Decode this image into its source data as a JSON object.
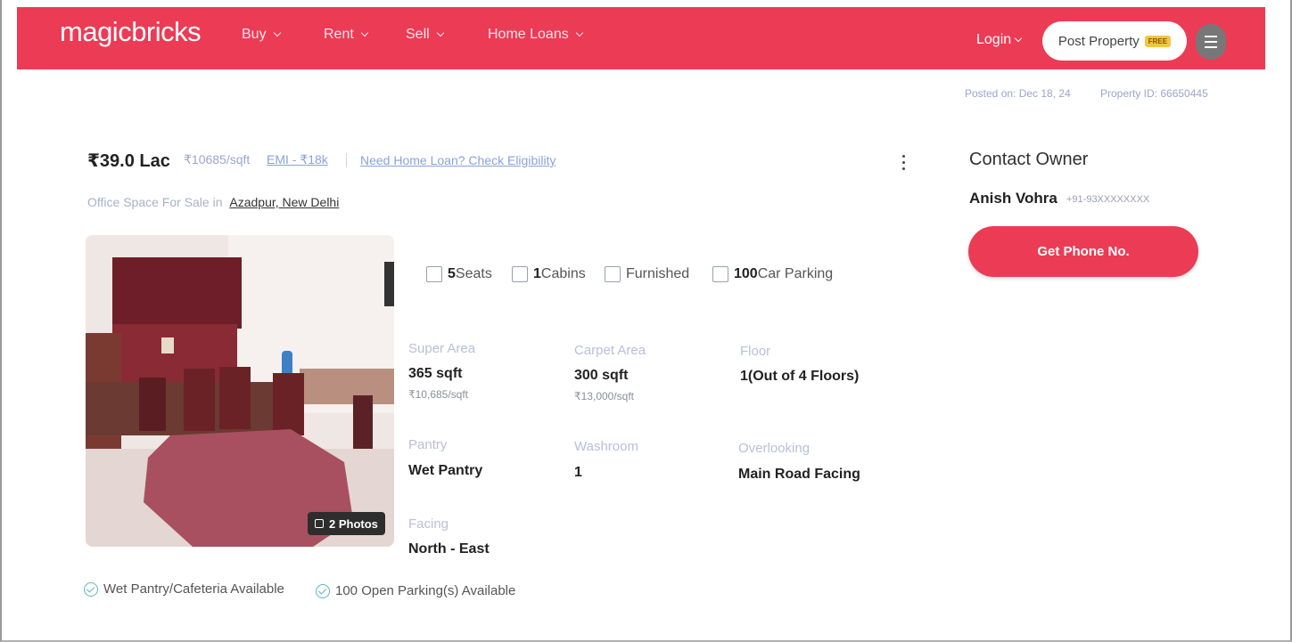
{
  "header": {
    "logo": "magicbricks",
    "nav": [
      {
        "label": "Buy"
      },
      {
        "label": "Rent"
      },
      {
        "label": "Sell"
      },
      {
        "label": "Home Loans"
      }
    ],
    "login_label": "Login",
    "post_property_label": "Post Property",
    "free_badge": "FREE"
  },
  "meta": {
    "posted_on": "Posted on: Dec 18, 24",
    "property_id": "Property ID: 66650445"
  },
  "listing": {
    "price": "₹39.0 Lac",
    "rate": "₹10685/sqft",
    "emi": "EMI - ₹18k",
    "loan_link": "Need Home Loan? Check Eligibility",
    "subtitle_prefix": "Office Space For Sale in",
    "location": "Azadpur, New Delhi",
    "photos_label": "2 Photos",
    "features": [
      {
        "value": "5",
        "label": "Seats",
        "icon": "seat-icon"
      },
      {
        "value": "1",
        "label": "Cabins",
        "icon": "cabin-icon"
      },
      {
        "value": "",
        "label": "Furnished",
        "icon": "furnished-icon"
      },
      {
        "value": "100",
        "label": "Car Parking",
        "icon": "car-parking-icon"
      }
    ],
    "attributes": {
      "super_area": {
        "label": "Super Area",
        "value": "365 sqft",
        "sub": "₹10,685/sqft"
      },
      "carpet_area": {
        "label": "Carpet Area",
        "value": "300 sqft",
        "sub": "₹13,000/sqft"
      },
      "floor": {
        "label": "Floor",
        "value": "1(Out of 4 Floors)"
      },
      "pantry": {
        "label": "Pantry",
        "value": "Wet Pantry"
      },
      "washroom": {
        "label": "Washroom",
        "value": "1"
      },
      "overlooking": {
        "label": "Overlooking",
        "value": "Main Road Facing"
      },
      "facing": {
        "label": "Facing",
        "value": "North - East"
      }
    },
    "amenities": [
      "Wet Pantry/Cafeteria Available",
      "100 Open Parking(s) Available"
    ]
  },
  "contact": {
    "title": "Contact Owner",
    "owner_name": "Anish Vohra",
    "owner_phone": "+91-93XXXXXXXX",
    "button_label": "Get Phone No."
  },
  "colors": {
    "brand": "#ec3b55",
    "link": "#8aa2d8",
    "muted": "#b8c0d6",
    "check": "#5ab7c9"
  }
}
